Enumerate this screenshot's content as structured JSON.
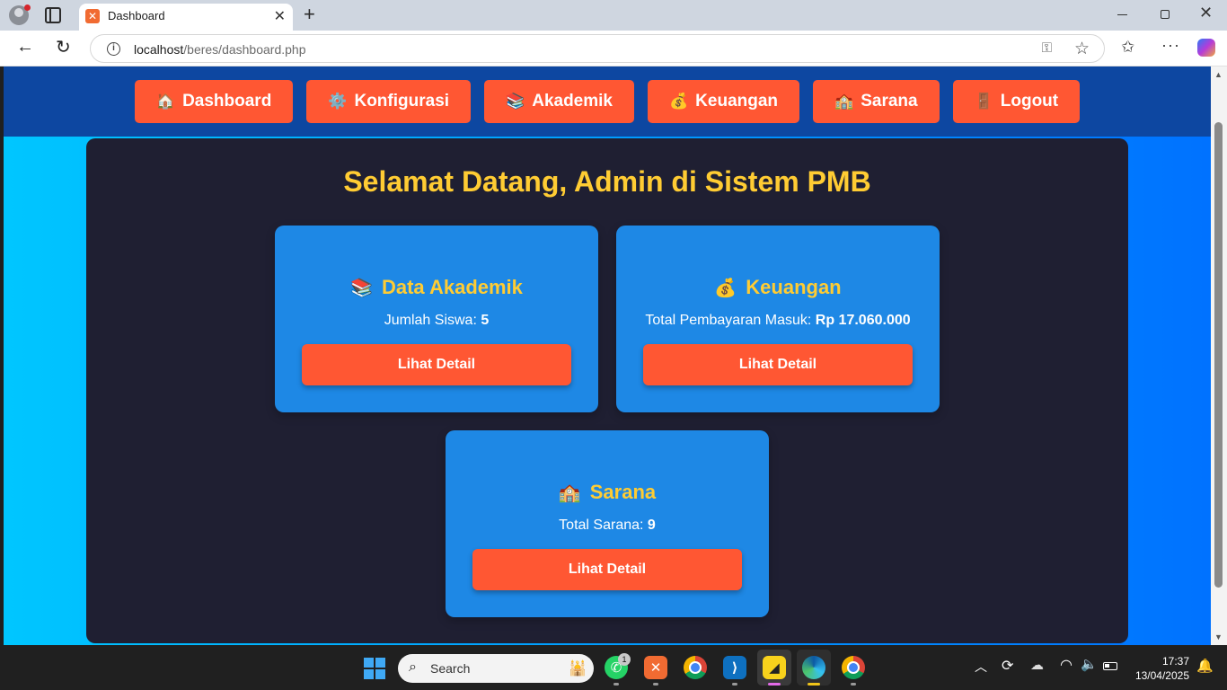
{
  "browser": {
    "tab_title": "Dashboard",
    "tab_favicon": "xampp-icon",
    "url_host": "localhost",
    "url_path": "/beres/dashboard.php"
  },
  "nav": {
    "items": [
      {
        "emoji": "🏠",
        "label": "Dashboard"
      },
      {
        "emoji": "⚙️",
        "label": "Konfigurasi"
      },
      {
        "emoji": "📚",
        "label": "Akademik"
      },
      {
        "emoji": "💰",
        "label": "Keuangan"
      },
      {
        "emoji": "🏫",
        "label": "Sarana"
      },
      {
        "emoji": "🚪",
        "label": "Logout"
      }
    ]
  },
  "main": {
    "welcome": "Selamat Datang, Admin di Sistem PMB",
    "cards": [
      {
        "emoji": "📚",
        "title": "Data Akademik",
        "stat_label": "Jumlah Siswa: ",
        "stat_value": "5",
        "button": "Lihat Detail"
      },
      {
        "emoji": "💰",
        "title": "Keuangan",
        "stat_label": "Total Pembayaran Masuk: ",
        "stat_value": "Rp 17.060.000",
        "button": "Lihat Detail"
      },
      {
        "emoji": "🏫",
        "title": "Sarana",
        "stat_label": "Total Sarana: ",
        "stat_value": "9",
        "button": "Lihat Detail"
      }
    ]
  },
  "taskbar": {
    "search_placeholder": "Search",
    "whatsapp_badge": "1",
    "time": "17:37",
    "date": "13/04/2025"
  },
  "colors": {
    "nav_bg": "#0d47a1",
    "button": "#ff5733",
    "panel": "#1f1f32",
    "card": "#1e88e5",
    "heading": "#ffcc33",
    "gradient_start": "#00c6ff",
    "gradient_end": "#0072ff"
  }
}
